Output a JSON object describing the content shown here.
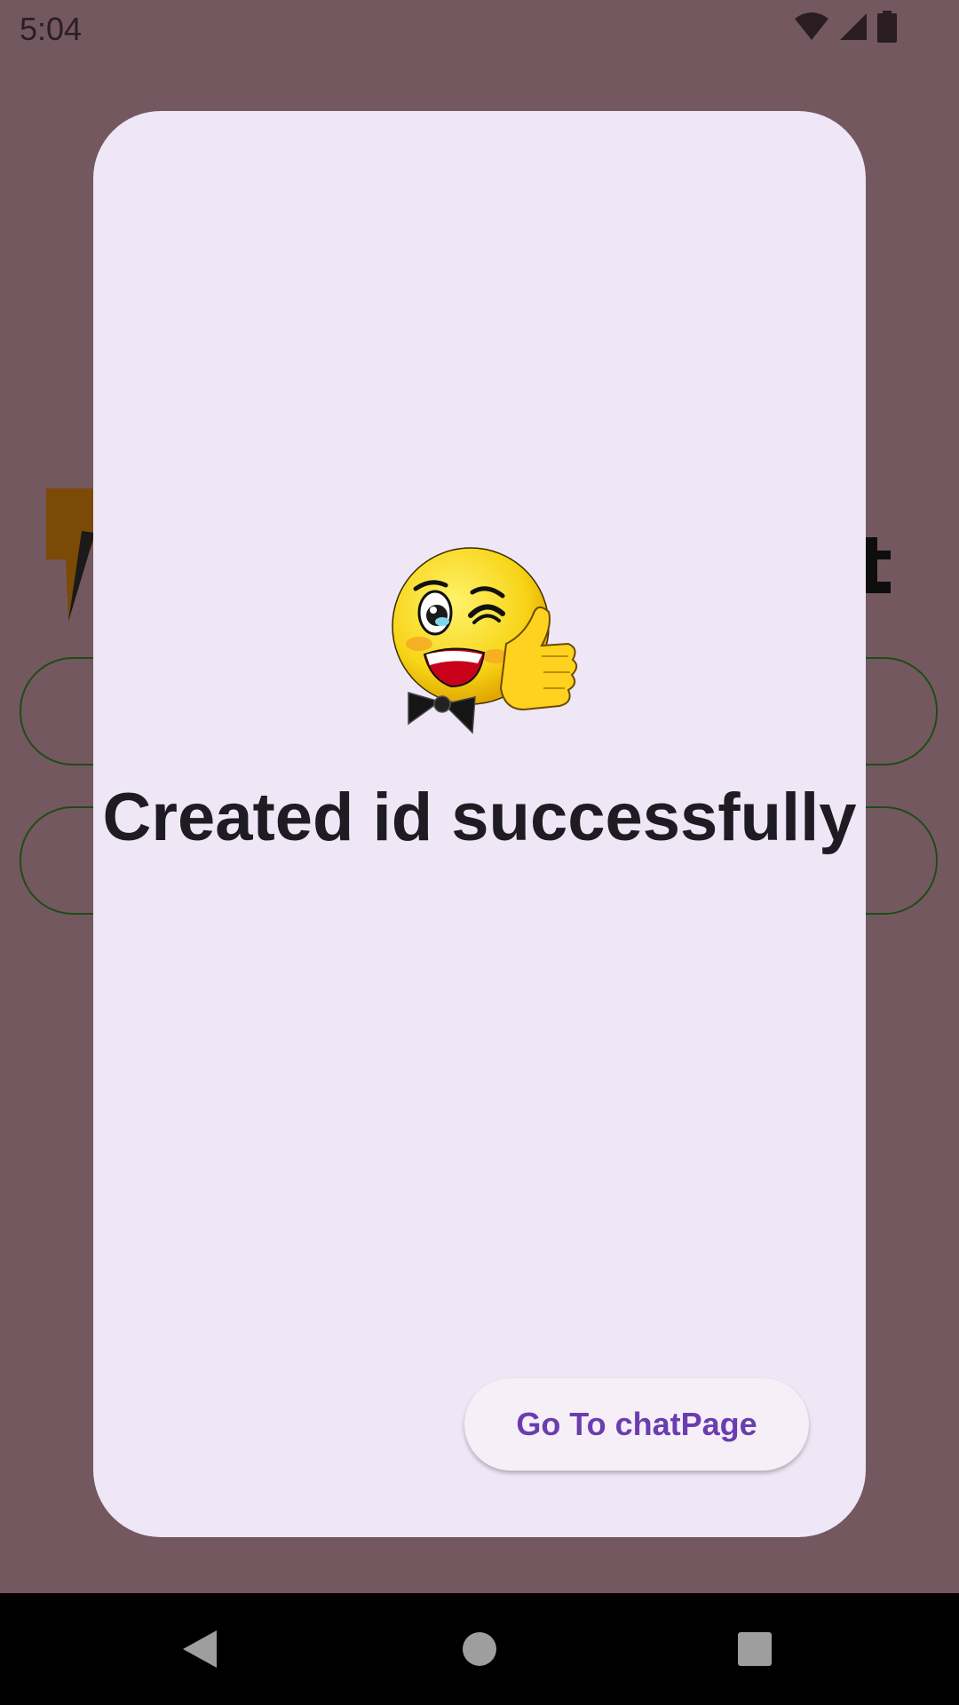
{
  "status_bar": {
    "time": "5:04",
    "icons": [
      "wifi-icon",
      "cell-signal-icon",
      "battery-icon"
    ]
  },
  "dialog": {
    "title": "Created id successfully",
    "image": "thumbs-up-wink-emoji",
    "button_label": "Go To chatPage"
  },
  "nav_bar": {
    "buttons": [
      "back-icon",
      "home-icon",
      "recents-icon"
    ]
  },
  "colors": {
    "scrim_background": "#735860",
    "dialog_background": "#efe6f6",
    "button_text": "#6a3db0",
    "title_text": "#1f1b22"
  }
}
